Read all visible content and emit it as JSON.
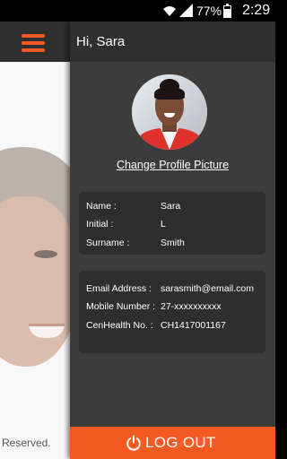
{
  "status_bar": {
    "battery_percent": "77%",
    "time": "2:29",
    "icons": [
      "wifi-icon",
      "signal-icon",
      "battery-icon"
    ]
  },
  "background": {
    "footer_text": "Reserved.",
    "menu_icon": "hamburger-menu-icon"
  },
  "drawer": {
    "greeting": "Hi, Sara",
    "change_picture_label": "Change Profile Picture",
    "personal": [
      {
        "label": "Name :",
        "value": "Sara"
      },
      {
        "label": "Initial :",
        "value": "L"
      },
      {
        "label": "Surname :",
        "value": "Smith"
      }
    ],
    "contact": [
      {
        "label": "Email Address :",
        "value": "sarasmith@email.com"
      },
      {
        "label": "Mobile Number :",
        "value": "27-xxxxxxxxxx"
      },
      {
        "label": "CenHealth No. :",
        "value": "CH1417001167"
      }
    ],
    "logout_label": "LOG OUT",
    "logout_icon": "power-icon"
  },
  "colors": {
    "accent": "#f35b22",
    "drawer_bg": "#3c3c3c",
    "header_bg": "#2f2f2f",
    "card_bg": "#2e2e2e"
  }
}
